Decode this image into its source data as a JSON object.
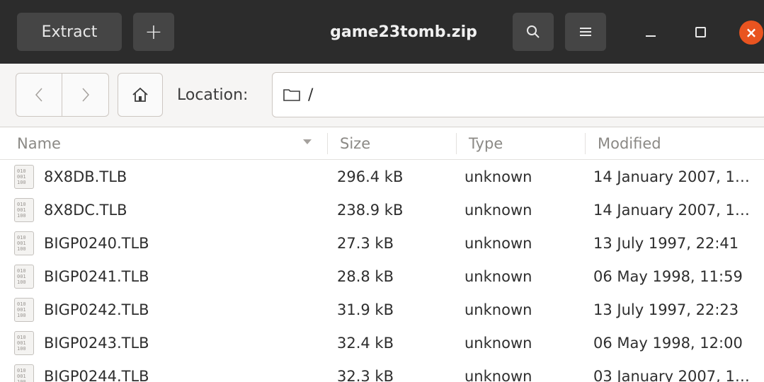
{
  "header": {
    "extract_label": "Extract",
    "add_label": "+",
    "title": "game23tomb.zip",
    "close_glyph": "×"
  },
  "location": {
    "label": "Location:",
    "path": "/"
  },
  "columns": {
    "name": "Name",
    "size": "Size",
    "type": "Type",
    "modified": "Modified"
  },
  "files": [
    {
      "name": "8X8DB.TLB",
      "size": "296.4 kB",
      "type": "unknown",
      "modified": "14 January 2007, 1…"
    },
    {
      "name": "8X8DC.TLB",
      "size": "238.9 kB",
      "type": "unknown",
      "modified": "14 January 2007, 1…"
    },
    {
      "name": "BIGP0240.TLB",
      "size": "27.3 kB",
      "type": "unknown",
      "modified": "13 July 1997, 22:41"
    },
    {
      "name": "BIGP0241.TLB",
      "size": "28.8 kB",
      "type": "unknown",
      "modified": "06 May 1998, 11:59"
    },
    {
      "name": "BIGP0242.TLB",
      "size": "31.9 kB",
      "type": "unknown",
      "modified": "13 July 1997, 22:23"
    },
    {
      "name": "BIGP0243.TLB",
      "size": "32.4 kB",
      "type": "unknown",
      "modified": "06 May 1998, 12:00"
    },
    {
      "name": "BIGP0244.TLB",
      "size": "32.3 kB",
      "type": "unknown",
      "modified": "03 January 2007, 1…"
    }
  ],
  "icons": {
    "file_icon_glyph": "010\n001\n100"
  },
  "colors": {
    "headerbar": "#2c2c2c",
    "close_button": "#e95420"
  }
}
